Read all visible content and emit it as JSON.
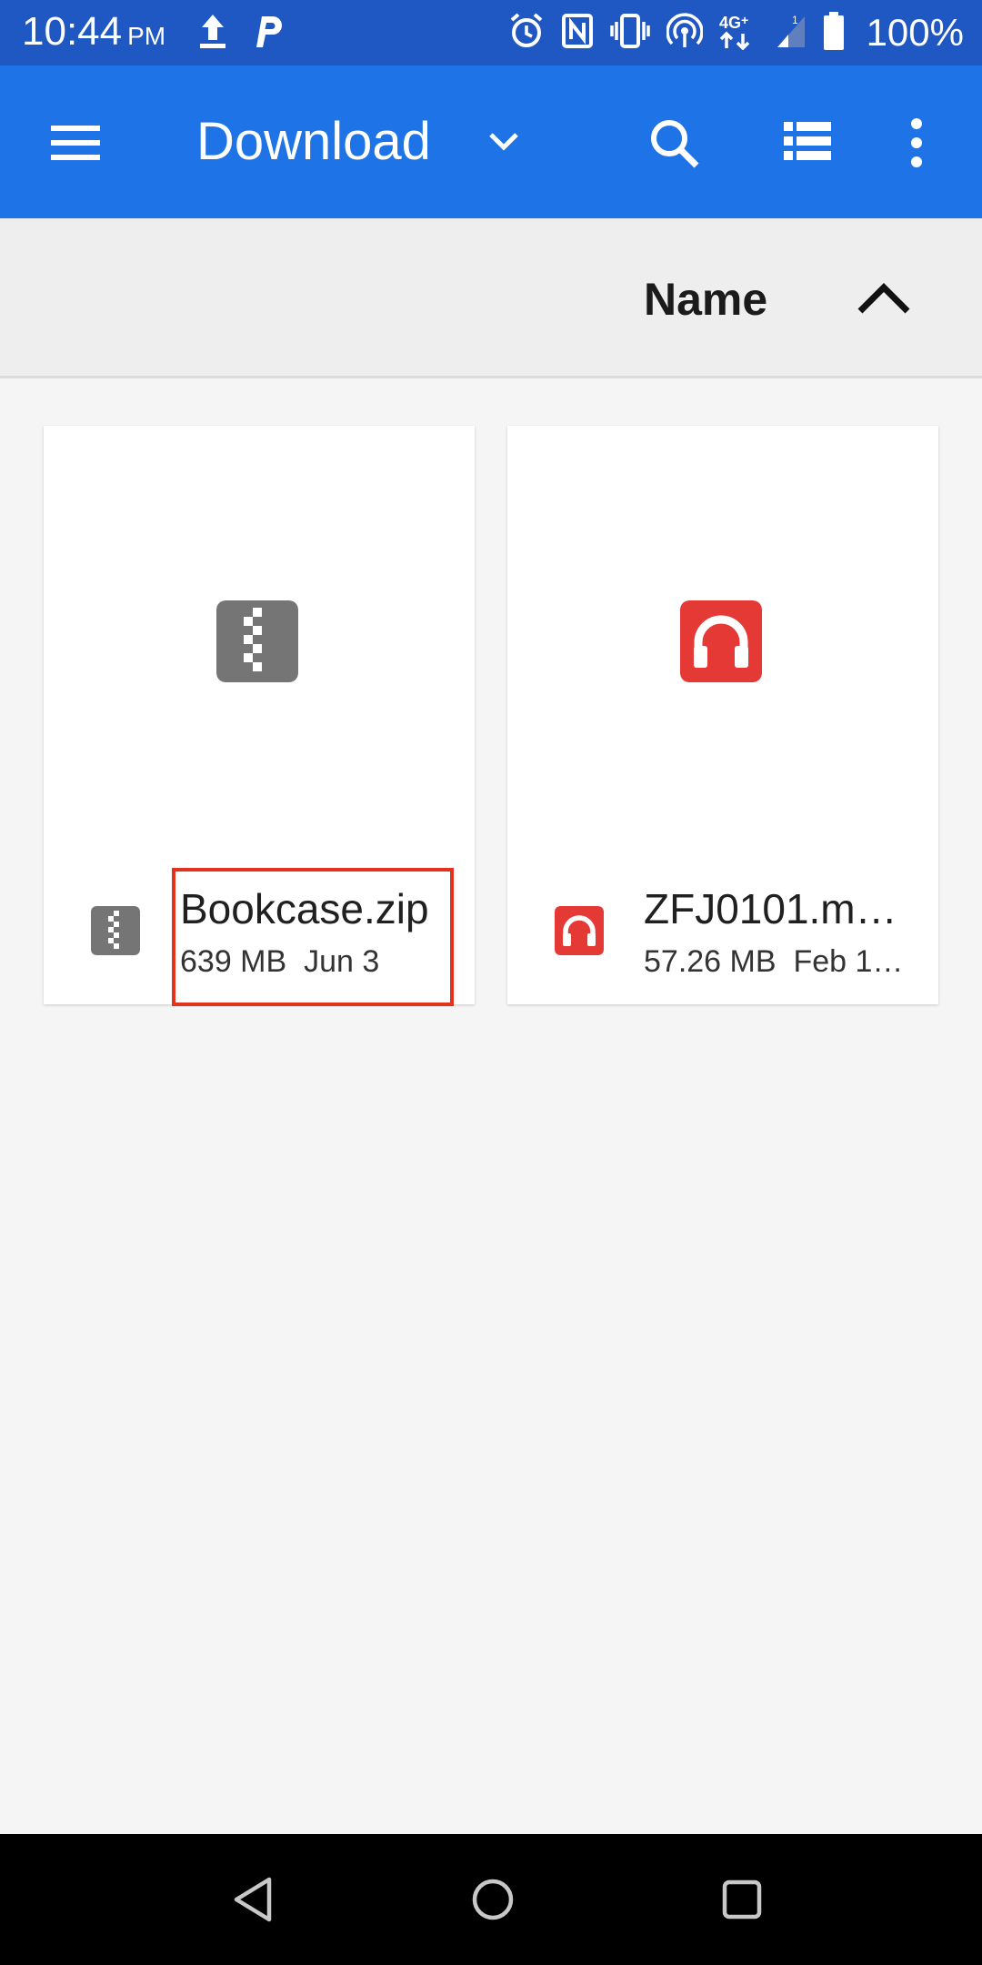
{
  "status_bar": {
    "time": "10:44",
    "ampm": "PM",
    "battery": "100%",
    "icons": [
      "upload-icon",
      "parking-app-icon",
      "alarm-icon",
      "nfc-icon",
      "vibrate-icon",
      "hotspot-icon",
      "4g-lte-icon",
      "signal-icon",
      "battery-icon"
    ]
  },
  "app_bar": {
    "title": "Download",
    "icons": [
      "menu-icon",
      "chevron-down-icon",
      "search-icon",
      "list-view-icon",
      "more-vert-icon"
    ],
    "color": "#1e74e6"
  },
  "sort_bar": {
    "label": "Name",
    "direction_icon": "chevron-up-icon"
  },
  "files": [
    {
      "name": "Bookcase.zip",
      "size": "639 MB",
      "date": "Jun 3",
      "type_icon": "zip-icon",
      "icon_color": "#757575"
    },
    {
      "name": "ZFJ0101.m…",
      "size": "57.26 MB",
      "date": "Feb 1…",
      "type_icon": "audio-icon",
      "icon_color": "#e53935"
    }
  ],
  "nav_bar": {
    "icons": [
      "back-icon",
      "home-icon",
      "recents-icon"
    ]
  }
}
